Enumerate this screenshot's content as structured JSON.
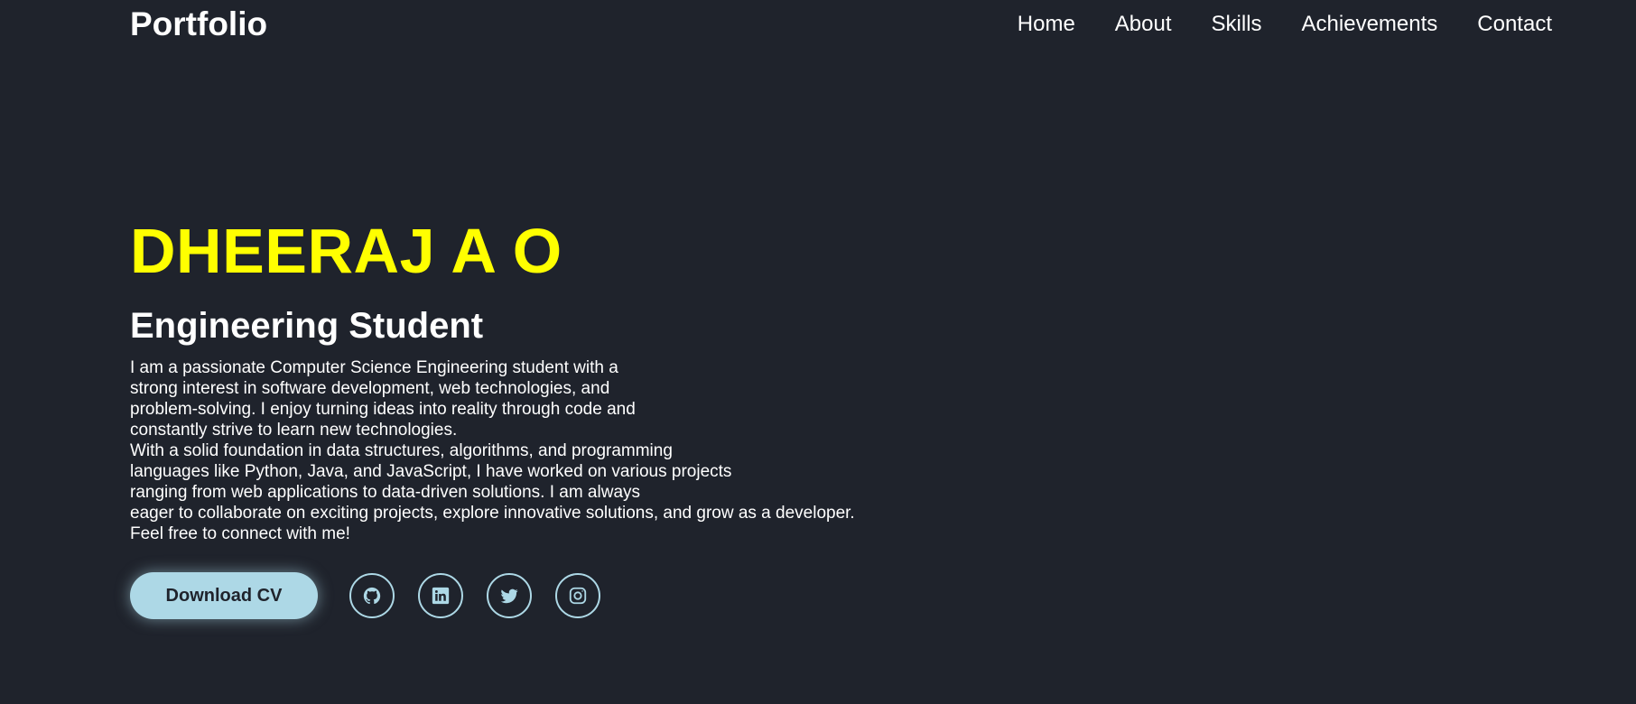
{
  "header": {
    "logo": "Portfolio",
    "nav": [
      {
        "label": "Home"
      },
      {
        "label": "About"
      },
      {
        "label": "Skills"
      },
      {
        "label": "Achievements"
      },
      {
        "label": "Contact"
      }
    ]
  },
  "hero": {
    "name": "DHEERAJ A O",
    "role": "Engineering Student",
    "bio": [
      "I am a passionate Computer Science Engineering student with a",
      "strong interest in software development, web technologies, and",
      "problem-solving. I enjoy turning ideas into reality through code and",
      "constantly strive to learn new technologies.",
      "With a solid foundation in data structures, algorithms, and programming",
      "languages like Python, Java, and JavaScript, I have worked on various projects",
      "ranging from web applications to data-driven solutions. I am always",
      "eager to collaborate on exciting projects, explore innovative solutions, and grow as a developer.",
      "Feel free to connect with me!"
    ],
    "cv_button": "Download CV",
    "socials": [
      {
        "icon": "github-icon"
      },
      {
        "icon": "linkedin-icon"
      },
      {
        "icon": "twitter-icon"
      },
      {
        "icon": "instagram-icon"
      }
    ]
  },
  "colors": {
    "background": "#1f232c",
    "name_accent": "#ffff00",
    "button": "#add8e6",
    "text": "#ffffff"
  }
}
